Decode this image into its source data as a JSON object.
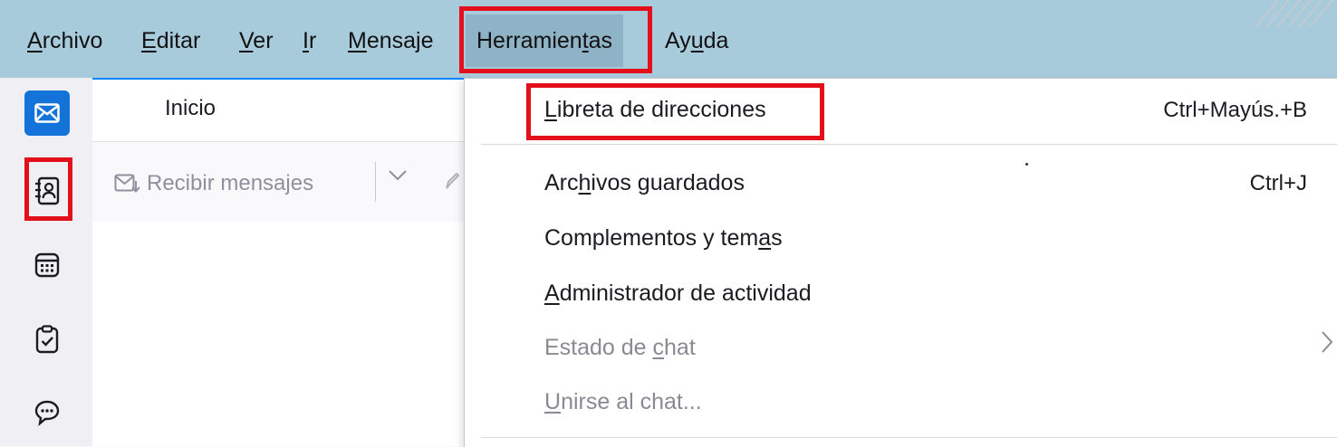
{
  "menubar": {
    "items": [
      {
        "pre": "",
        "key": "A",
        "post": "rchivo"
      },
      {
        "pre": "",
        "key": "E",
        "post": "ditar"
      },
      {
        "pre": "",
        "key": "V",
        "post": "er"
      },
      {
        "pre": "",
        "key": "I",
        "post": "r"
      },
      {
        "pre": "",
        "key": "M",
        "post": "ensaje"
      },
      {
        "pre": "Herramien",
        "key": "t",
        "post": "as"
      },
      {
        "pre": "Ay",
        "key": "u",
        "post": "da"
      }
    ]
  },
  "spaces": {
    "items": [
      {
        "name": "mail-icon"
      },
      {
        "name": "address-book-icon"
      },
      {
        "name": "calendar-icon"
      },
      {
        "name": "tasks-icon"
      },
      {
        "name": "chat-icon"
      }
    ]
  },
  "tab": {
    "label": "Inicio"
  },
  "toolbar": {
    "get_messages": "Recibir mensajes"
  },
  "tools_menu": {
    "items": [
      {
        "pre": "",
        "key": "L",
        "post": "ibreta de direcciones",
        "shortcut": "Ctrl+Mayús.+B",
        "disabled": false
      },
      {
        "pre": "Arc",
        "key": "h",
        "post": "ivos guardados",
        "shortcut": "Ctrl+J",
        "disabled": false
      },
      {
        "pre": "Complementos y tem",
        "key": "a",
        "post": "s",
        "shortcut": "",
        "disabled": false
      },
      {
        "pre": "",
        "key": "A",
        "post": "dministrador de actividad",
        "shortcut": "",
        "disabled": false
      },
      {
        "pre": "Estado de ",
        "key": "c",
        "post": "hat",
        "shortcut": "",
        "disabled": true
      },
      {
        "pre": "",
        "key": "U",
        "post": "nirse al chat...",
        "shortcut": "",
        "disabled": true
      }
    ]
  },
  "colors": {
    "menubar_bg": "#a8cbdc",
    "highlight_box": "#e3101c",
    "accent": "#1373d9"
  }
}
